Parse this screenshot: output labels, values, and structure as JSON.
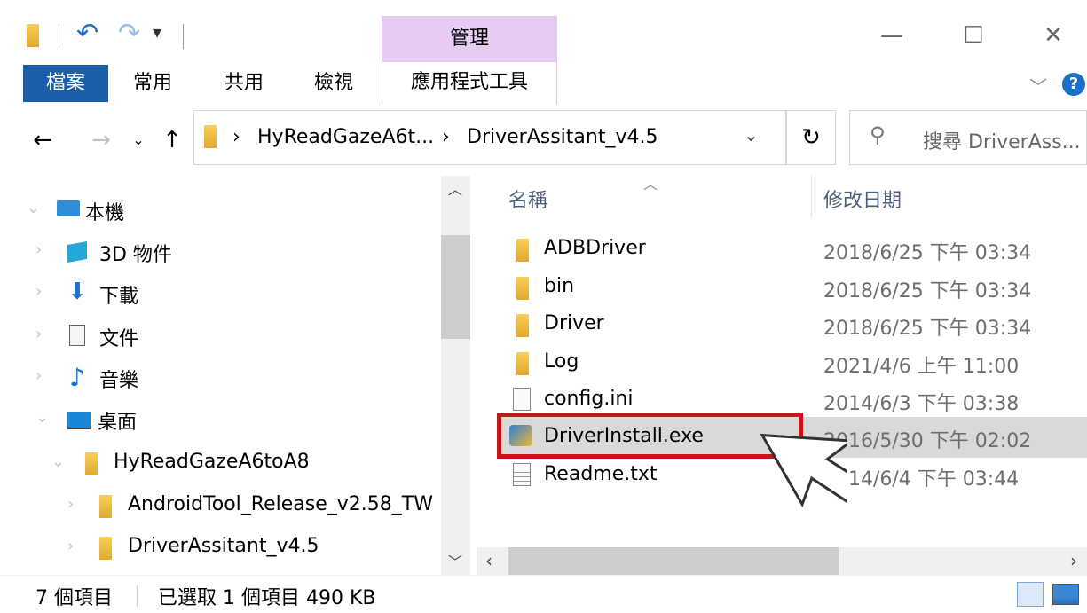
{
  "titlebar": {
    "manage_label": "管理",
    "minimize_glyph": "—",
    "maximize_glyph": "☐",
    "close_glyph": "✕"
  },
  "ribbon": {
    "tabs": [
      "檔案",
      "常用",
      "共用",
      "檢視",
      "應用程式工具"
    ],
    "help_label": "?"
  },
  "address": {
    "crumbs": [
      "HyReadGazeA6t...",
      "DriverAssitant_v4.5"
    ],
    "search_placeholder": "搜尋 DriverAss..."
  },
  "nav": {
    "items": [
      {
        "label": "本機",
        "icon": "computer-icon"
      },
      {
        "label": "3D 物件",
        "icon": "3d-objects-icon"
      },
      {
        "label": "下載",
        "icon": "download-icon"
      },
      {
        "label": "文件",
        "icon": "document-icon"
      },
      {
        "label": "音樂",
        "icon": "music-icon"
      },
      {
        "label": "桌面",
        "icon": "desktop-icon"
      },
      {
        "label": "HyReadGazeA6toA8",
        "icon": "folder-icon"
      },
      {
        "label": "AndroidTool_Release_v2.58_TW",
        "icon": "folder-icon"
      },
      {
        "label": "DriverAssitant_v4.5",
        "icon": "folder-icon"
      }
    ]
  },
  "filelist": {
    "columns": [
      "名稱",
      "修改日期"
    ],
    "rows": [
      {
        "name": "ADBDriver",
        "date": "2018/6/25 下午 03:34",
        "icon": "folder-icon"
      },
      {
        "name": "bin",
        "date": "2018/6/25 下午 03:34",
        "icon": "folder-icon"
      },
      {
        "name": "Driver",
        "date": "2018/6/25 下午 03:34",
        "icon": "folder-icon"
      },
      {
        "name": "Log",
        "date": "2021/4/6 上午 11:00",
        "icon": "folder-icon"
      },
      {
        "name": "config.ini",
        "date": "2014/6/3 下午 03:38",
        "icon": "settings-file-icon"
      },
      {
        "name": "DriverInstall.exe",
        "date": "2016/5/30 下午 02:02",
        "icon": "installer-icon"
      },
      {
        "name": "Readme.txt",
        "date": "2014/6/4 下午 03:44",
        "icon": "text-file-icon"
      }
    ],
    "selected_row": "DriverInstall.exe"
  },
  "status": {
    "item_count": "7 個項目",
    "selection": "已選取 1 個項目  490 KB"
  },
  "colors": {
    "file_tab": "#1a5fa8",
    "manage_tab": "#e6ccf2",
    "highlight_box": "#c4161c",
    "selected_row": "#d9d9d9"
  }
}
